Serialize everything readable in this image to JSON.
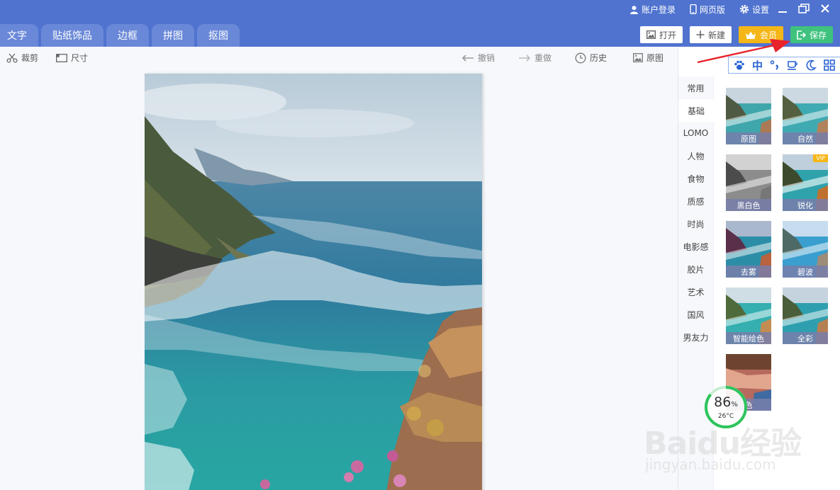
{
  "titlebar": {
    "links": {
      "account": "账户登录",
      "web": "网页版",
      "settings": "设置"
    }
  },
  "tabs": [
    "文字",
    "贴纸饰品",
    "边框",
    "拼图",
    "抠图"
  ],
  "actions": {
    "open": "打开",
    "new": "新建",
    "vip": "会员",
    "save": "保存"
  },
  "tools": {
    "crop": "裁剪",
    "size": "尺寸",
    "undo": "撤销",
    "redo": "重做",
    "history": "历史",
    "original": "原图"
  },
  "ime": {
    "lang": "中"
  },
  "filter_categories": [
    "常用",
    "基础",
    "LOMO",
    "人物",
    "食物",
    "质感",
    "时尚",
    "电影感",
    "胶片",
    "艺术",
    "国风",
    "男友力"
  ],
  "active_category": 1,
  "filters": [
    {
      "label": "原图",
      "vip": false
    },
    {
      "label": "自然",
      "vip": false
    },
    {
      "label": "黑白色",
      "vip": false
    },
    {
      "label": "锐化",
      "vip": true,
      "vip_text": "VIP"
    },
    {
      "label": "去雾",
      "vip": false
    },
    {
      "label": "碧波",
      "vip": false
    },
    {
      "label": "智能绘色",
      "vip": false
    },
    {
      "label": "全彩",
      "vip": false
    },
    {
      "label": "色",
      "vip": false
    }
  ],
  "perf": {
    "value": "86",
    "unit": "%",
    "temp": "26°C"
  },
  "watermark": {
    "main": "Baidu经验",
    "sub": "jingyan.baidu.com"
  },
  "colors": {
    "titlebar": "#4f73cf",
    "tab": "#6a88d8",
    "save": "#3ec27e",
    "vip": "#f5b617",
    "arrow": "#e8232c"
  }
}
